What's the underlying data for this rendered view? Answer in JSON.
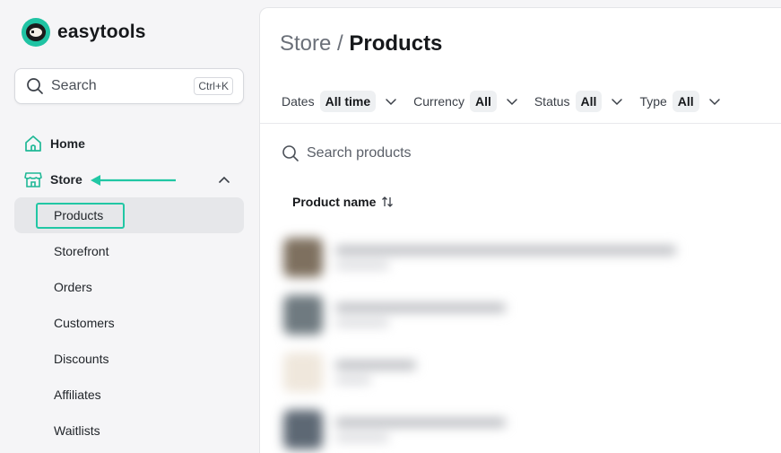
{
  "app": {
    "name": "easytools"
  },
  "sidebar": {
    "search": {
      "label": "Search",
      "shortcut": "Ctrl+K"
    },
    "nav": [
      {
        "label": "Home",
        "icon": "home-icon"
      },
      {
        "label": "Store",
        "icon": "store-icon",
        "expanded": true
      }
    ],
    "store_items": [
      {
        "label": "Products",
        "active": true
      },
      {
        "label": "Storefront"
      },
      {
        "label": "Orders"
      },
      {
        "label": "Customers"
      },
      {
        "label": "Discounts"
      },
      {
        "label": "Affiliates"
      },
      {
        "label": "Waitlists"
      }
    ]
  },
  "main": {
    "breadcrumb": {
      "parent": "Store",
      "separator": " / ",
      "current": "Products"
    },
    "filters": [
      {
        "label": "Dates",
        "value": "All time"
      },
      {
        "label": "Currency",
        "value": "All"
      },
      {
        "label": "Status",
        "value": "All"
      },
      {
        "label": "Type",
        "value": "All"
      }
    ],
    "search_placeholder": "Search products",
    "table": {
      "columns": [
        "Product name"
      ],
      "blurred_rows": 4
    }
  },
  "colors": {
    "accent": "#21c7a4",
    "sidebar_bg": "#f5f5f7",
    "active_item_bg": "#e6e7ea"
  }
}
